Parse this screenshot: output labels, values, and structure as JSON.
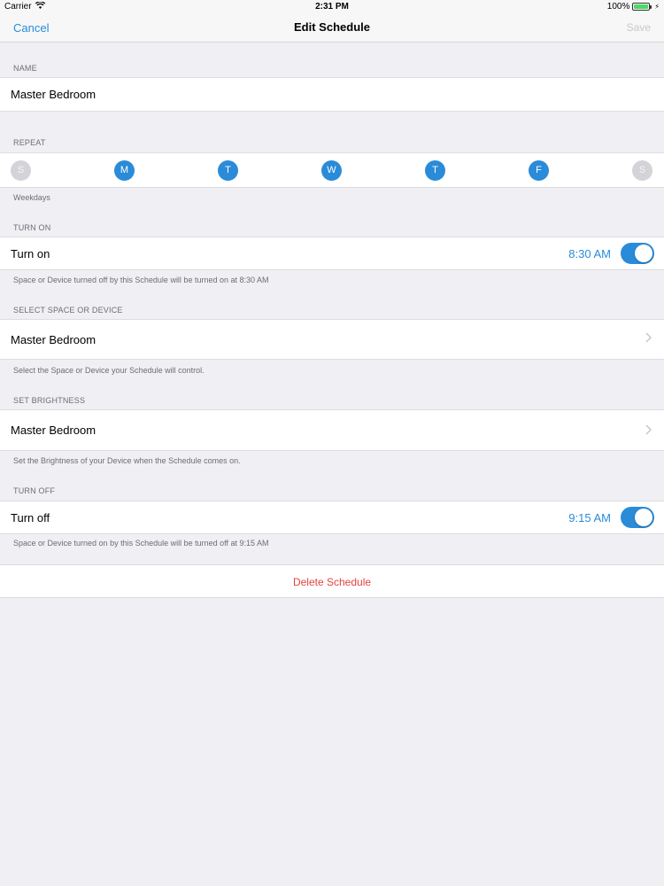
{
  "status_bar": {
    "carrier": "Carrier",
    "time": "2:31 PM",
    "battery": "100%"
  },
  "nav": {
    "cancel": "Cancel",
    "title": "Edit Schedule",
    "save": "Save"
  },
  "name_section": {
    "header": "NAME",
    "value": "Master Bedroom"
  },
  "repeat_section": {
    "header": "REPEAT",
    "days": [
      {
        "label": "S",
        "selected": false
      },
      {
        "label": "M",
        "selected": true
      },
      {
        "label": "T",
        "selected": true
      },
      {
        "label": "W",
        "selected": true
      },
      {
        "label": "T",
        "selected": true
      },
      {
        "label": "F",
        "selected": true
      },
      {
        "label": "S",
        "selected": false
      }
    ],
    "footer": "Weekdays"
  },
  "turn_on_section": {
    "header": "TURN ON",
    "label": "Turn on",
    "time": "8:30 AM",
    "enabled": true,
    "footer": "Space or Device turned off by this Schedule will be turned on at 8:30 AM"
  },
  "space_section": {
    "header": "SELECT SPACE OR DEVICE",
    "value": "Master Bedroom",
    "footer": "Select the Space or Device your Schedule will control."
  },
  "brightness_section": {
    "header": "SET BRIGHTNESS",
    "value": "Master Bedroom",
    "footer": "Set the Brightness of your Device when the Schedule comes on."
  },
  "turn_off_section": {
    "header": "TURN OFF",
    "label": "Turn off",
    "time": "9:15 AM",
    "enabled": true,
    "footer": "Space or Device turned on by this Schedule will be turned off at 9:15 AM"
  },
  "delete_label": "Delete Schedule",
  "colors": {
    "accent": "#2a8bd8",
    "destructive": "#e0443e",
    "background": "#efeff4",
    "day_off": "#d4d4d8"
  },
  "icons": {
    "wifi": "wifi-icon",
    "battery": "battery-icon",
    "charging": "charging-bolt-icon",
    "chevron": "chevron-right-icon"
  }
}
